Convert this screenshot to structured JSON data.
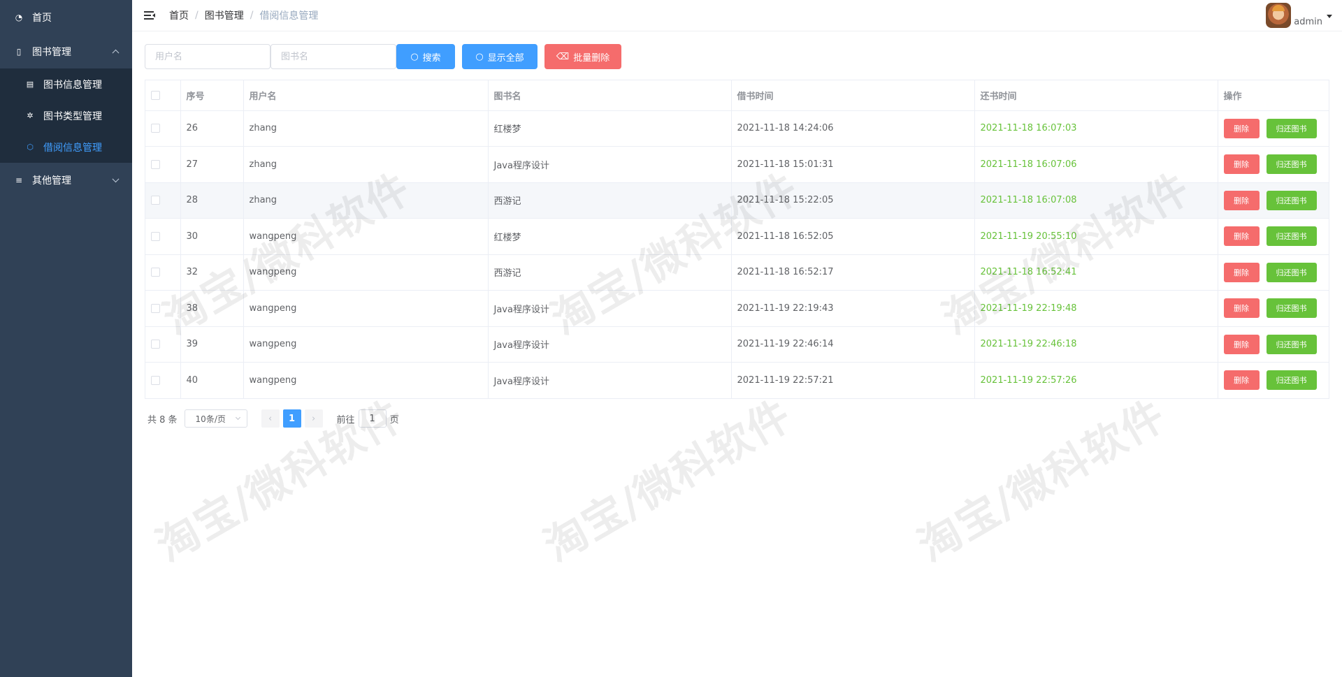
{
  "sidebar": {
    "home": {
      "label": "首页",
      "icon": "dashboard-icon"
    },
    "book_mgmt": {
      "label": "图书管理",
      "icon": "book-icon",
      "children": [
        {
          "label": "图书信息管理",
          "icon": "document-icon"
        },
        {
          "label": "图书类型管理",
          "icon": "category-icon"
        },
        {
          "label": "借阅信息管理",
          "icon": "borrow-icon",
          "active": true
        }
      ]
    },
    "other_mgmt": {
      "label": "其他管理",
      "icon": "menu-list-icon"
    }
  },
  "header": {
    "breadcrumb": [
      "首页",
      "图书管理",
      "借阅信息管理"
    ],
    "user_name": "admin"
  },
  "search": {
    "username_placeholder": "用户名",
    "bookname_placeholder": "图书名",
    "search_label": "搜索",
    "show_all_label": "显示全部",
    "batch_delete_label": "批量删除"
  },
  "table": {
    "columns": [
      "",
      "序号",
      "用户名",
      "图书名",
      "借书时间",
      "还书时间",
      "操作"
    ],
    "rows": [
      {
        "id": "26",
        "user": "zhang",
        "book": "红楼梦",
        "borrow": "2021-11-18 14:24:06",
        "return": "2021-11-18 16:07:03"
      },
      {
        "id": "27",
        "user": "zhang",
        "book": "Java程序设计",
        "borrow": "2021-11-18 15:01:31",
        "return": "2021-11-18 16:07:06"
      },
      {
        "id": "28",
        "user": "zhang",
        "book": "西游记",
        "borrow": "2021-11-18 15:22:05",
        "return": "2021-11-18 16:07:08"
      },
      {
        "id": "30",
        "user": "wangpeng",
        "book": "红楼梦",
        "borrow": "2021-11-18 16:52:05",
        "return": "2021-11-19 20:55:10"
      },
      {
        "id": "32",
        "user": "wangpeng",
        "book": "西游记",
        "borrow": "2021-11-18 16:52:17",
        "return": "2021-11-18 16:52:41"
      },
      {
        "id": "38",
        "user": "wangpeng",
        "book": "Java程序设计",
        "borrow": "2021-11-19 22:19:43",
        "return": "2021-11-19 22:19:48"
      },
      {
        "id": "39",
        "user": "wangpeng",
        "book": "Java程序设计",
        "borrow": "2021-11-19 22:46:14",
        "return": "2021-11-19 22:46:18"
      },
      {
        "id": "40",
        "user": "wangpeng",
        "book": "Java程序设计",
        "borrow": "2021-11-19 22:57:21",
        "return": "2021-11-19 22:57:26"
      }
    ],
    "delete_label": "删除",
    "return_label": "归还图书"
  },
  "pagination": {
    "total": "共 8 条",
    "page_size": "10条/页",
    "current_page": "1",
    "goto_prefix": "前往",
    "goto_value": "1",
    "goto_suffix": "页"
  },
  "watermark": "淘宝/微科软件",
  "colors": {
    "sidebar_bg": "#304156",
    "submenu_bg": "#1f2d3d",
    "primary": "#409eff",
    "danger": "#f56c6c",
    "success": "#67c23a"
  }
}
